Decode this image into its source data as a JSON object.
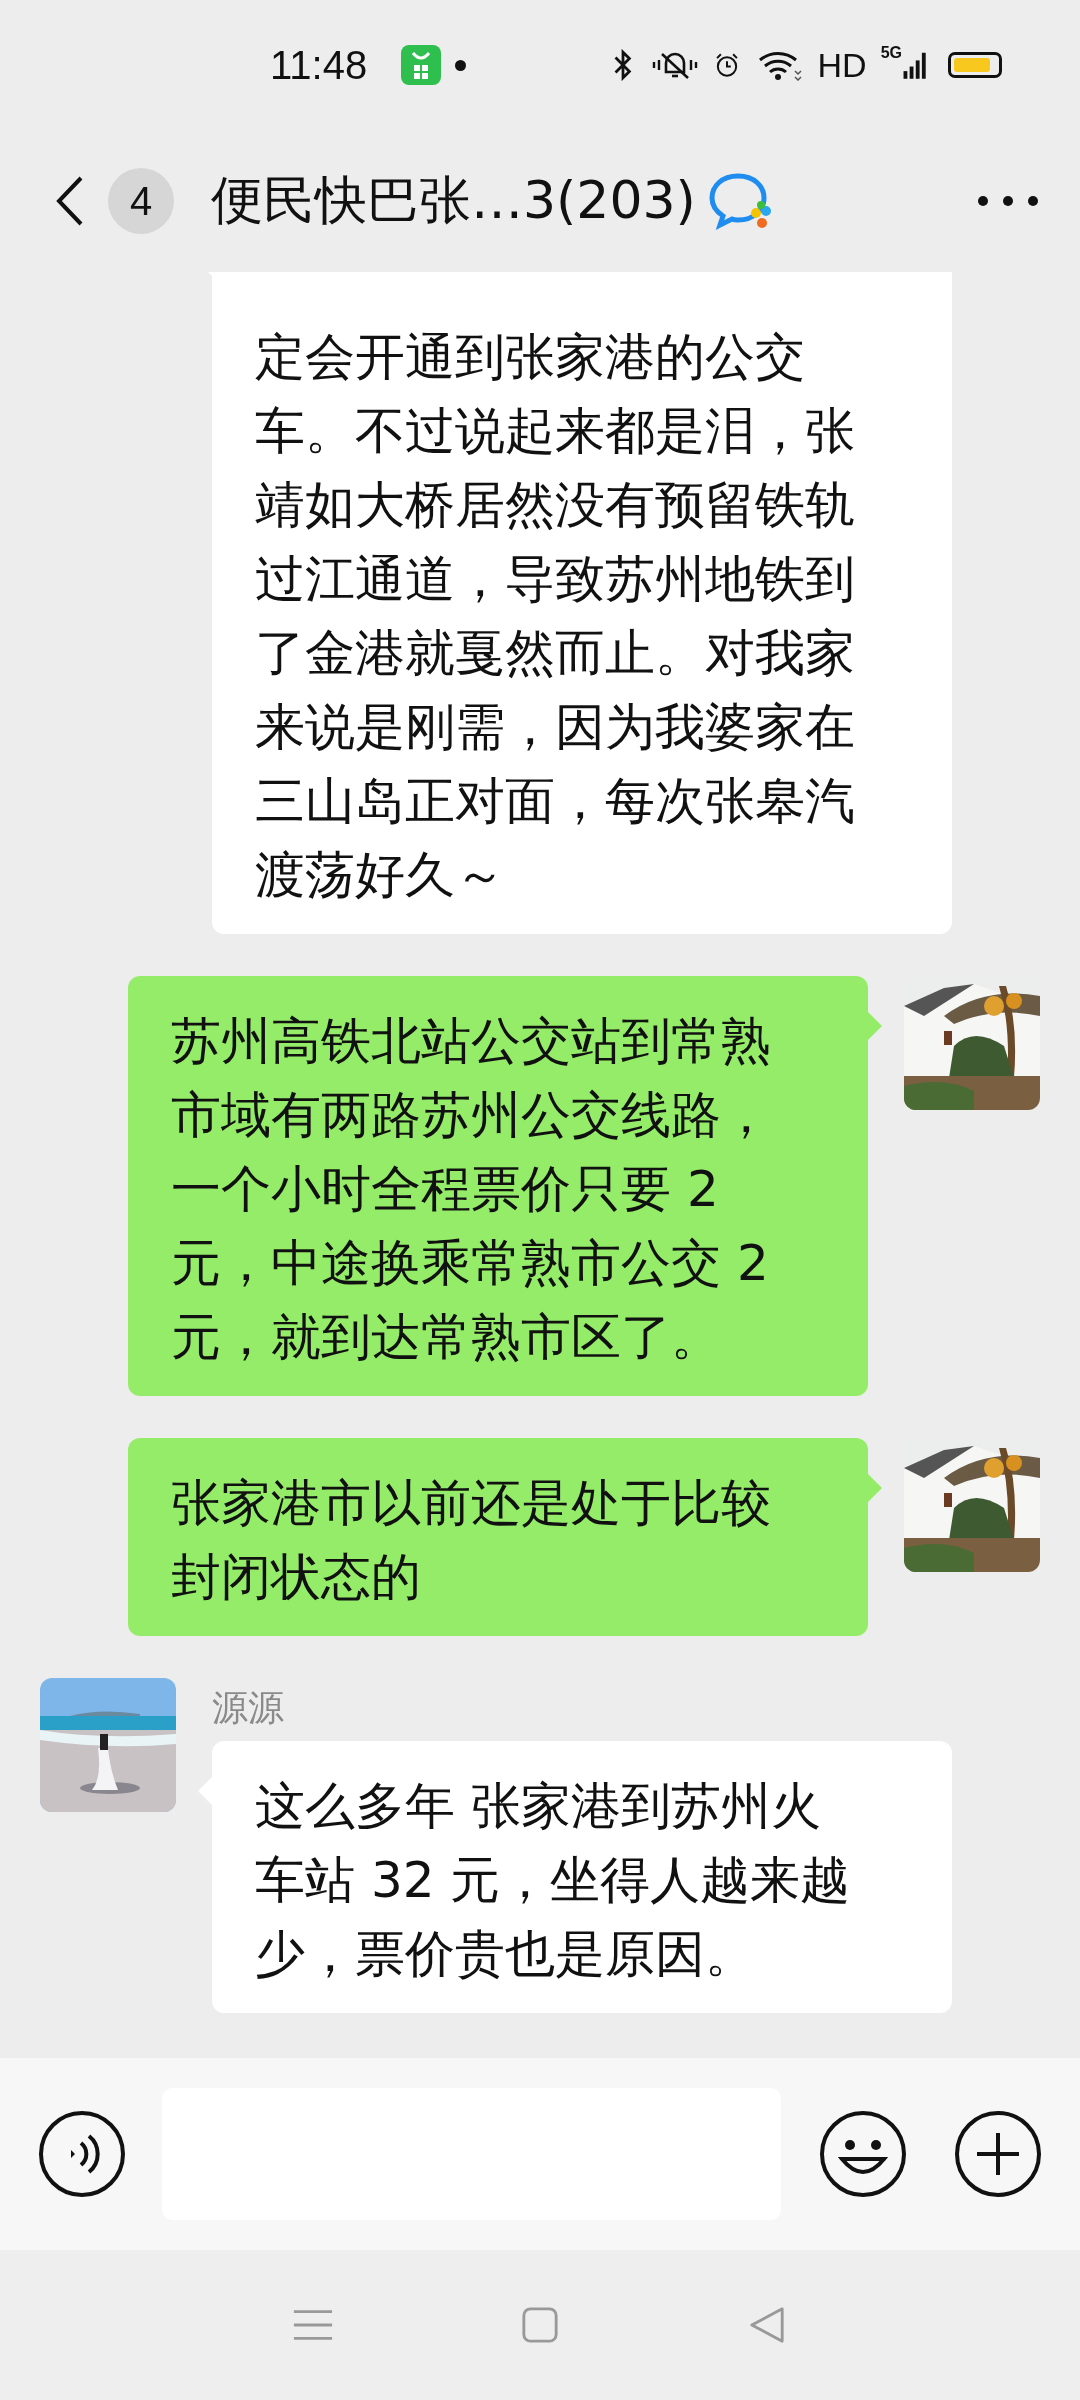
{
  "status_bar": {
    "time": "11:48",
    "network_label": "HD",
    "cell_label": "5G"
  },
  "header": {
    "back_badge": "4",
    "title": "便民快巴张…3(203)"
  },
  "messages": [
    {
      "kind": "received",
      "avatar": false,
      "lines": [
        "定会开通到张家港的公交",
        "车。不过说起来都是泪，张",
        "靖如大桥居然没有预留铁轨",
        "过江通道，导致苏州地铁到",
        "了金港就戛然而止。对我家",
        "来说是刚需，因为我婆家在",
        "三山岛正对面，每次张皋汽",
        "渡荡好久～"
      ]
    },
    {
      "kind": "sent",
      "avatar": true,
      "lines": [
        "苏州高铁北站公交站到常熟",
        "市域有两路苏州公交线路，",
        "一个小时全程票价只要 2",
        "元，中途换乘常熟市公交 2",
        "元，就到达常熟市区了。"
      ]
    },
    {
      "kind": "sent",
      "avatar": true,
      "lines": [
        "张家港市以前还是处于比较",
        "封闭状态的"
      ]
    },
    {
      "kind": "received",
      "avatar": true,
      "sender": "源源",
      "lines": [
        "这么多年 张家港到苏州火",
        "车站 32 元，坐得人越来越",
        "少，票价贵也是原因。"
      ]
    }
  ]
}
